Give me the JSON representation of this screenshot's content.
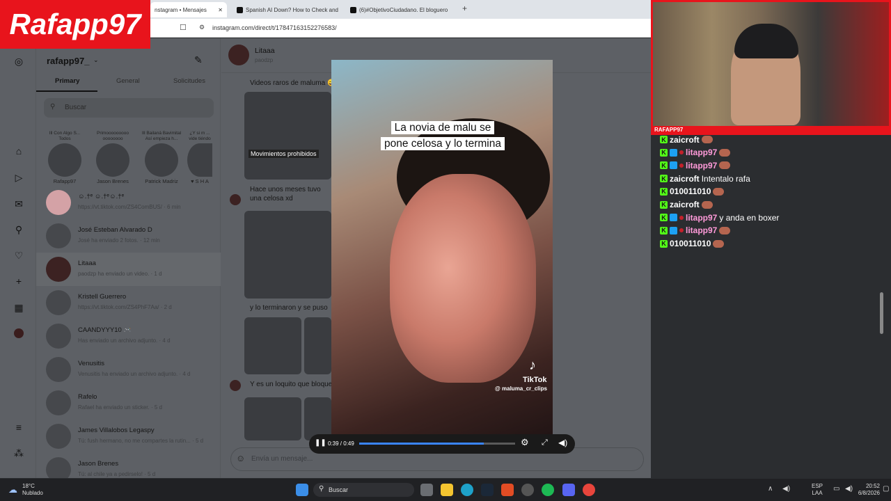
{
  "browser": {
    "tabs": [
      {
        "label": "nstagram • Mensajes"
      },
      {
        "label": "Spanish AI Down? How to Check and"
      },
      {
        "label": "(6)#ObjetivoCiudadano. El bloguero"
      }
    ],
    "url": "instagram.com/direct/t/17847163152276583/"
  },
  "instagram": {
    "username": "rafapp97_",
    "tabs": [
      "Primary",
      "General",
      "Solicitudes"
    ],
    "search_placeholder": "Buscar",
    "stories": [
      {
        "caption": "Ill Con Algo S... Todos",
        "name": "Rafapp97"
      },
      {
        "caption": "Primooooooooo oooooooo",
        "name": "Jason Brenes"
      },
      {
        "caption": "Ill Bailaná Bavimital Así empieza h...",
        "name": "Patrick Madriz"
      },
      {
        "caption": "¿Y si m ... vide tiéndo",
        "name": "♥ S H A"
      }
    ],
    "conversations": [
      {
        "name": "☺.†ᵉ ☺.†ᵉ☺.†ᵉ",
        "preview": "https://vt.tiktok.com/ZS4ComBUS/ · 6 min"
      },
      {
        "name": "José Esteban Alvarado D",
        "preview": "José ha enviado 2 fotos. · 12 min"
      },
      {
        "name": "Litaaa",
        "preview": "paodzp ha enviado un video. · 1 d"
      },
      {
        "name": "Kristell Guerrero",
        "preview": "https://vt.tiktok.com/ZS4PhF7Aa/ · 2 d"
      },
      {
        "name": "CAANDYYY10 🎮",
        "preview": "Has enviado un archivo adjunto. · 4 d"
      },
      {
        "name": "Venusitis",
        "preview": "Venusitis ha enviado un archivo adjunto. · 4 d"
      },
      {
        "name": "Rafelo",
        "preview": "Rafael ha enviado un sticker. · 5 d"
      },
      {
        "name": "James Villalobos Legaspy",
        "preview": "Tú: fush hermano, no me compartes la rutin... · 5 d"
      },
      {
        "name": "Jason Brenes",
        "preview": "Tú: al chile ya a pedirselo! · 5 d"
      }
    ],
    "chat": {
      "contact_name": "Litaaa",
      "contact_handle": "paodzp",
      "messages": [
        "Videos raros de maluma 😅",
        "Movimientos prohibidos",
        "Hace unos meses tuvo una celosa xd",
        "y lo terminaron y se puso",
        "Y es un loquito que bloque"
      ],
      "input_placeholder": "Envía un mensaje..."
    },
    "video": {
      "caption_line1": "La novia de malu se",
      "caption_line2": "pone celosa y lo termina",
      "watermark": "TikTok",
      "watermark_handle": "@ maluma_cr_clips",
      "time": "0:39 / 0:49",
      "progress": 0.8
    }
  },
  "overlay": {
    "logo": "Rafapp97",
    "streamer_label": "RAFAPP97",
    "chat": [
      {
        "user": "zaicroft",
        "text": "",
        "style": "u1",
        "sub": false
      },
      {
        "user": "litapp97",
        "text": "",
        "style": "u2",
        "sub": true
      },
      {
        "user": "litapp97",
        "text": "",
        "style": "u2",
        "sub": true
      },
      {
        "user": "zaicroft",
        "text": "Intentalo rafa",
        "style": "u1",
        "sub": false
      },
      {
        "user": "010011010",
        "text": "",
        "style": "u1",
        "sub": false
      },
      {
        "user": "zaicroft",
        "text": "",
        "style": "u1",
        "sub": false
      },
      {
        "user": "litapp97",
        "text": "y anda en boxer",
        "style": "u2",
        "sub": true
      },
      {
        "user": "litapp97",
        "text": "",
        "style": "u2",
        "sub": true
      },
      {
        "user": "010011010",
        "text": "",
        "style": "u1",
        "sub": false
      }
    ]
  },
  "taskbar": {
    "weather_temp": "18°C",
    "weather_desc": "Nublado",
    "search": "Buscar",
    "lang": "ESP",
    "lang2": "LAA",
    "time": "20:52",
    "date": "6/8/2026"
  },
  "colors": {
    "accent": "#e8141c",
    "kick": "#53fc18",
    "pink_user": "#ff9ad9"
  }
}
